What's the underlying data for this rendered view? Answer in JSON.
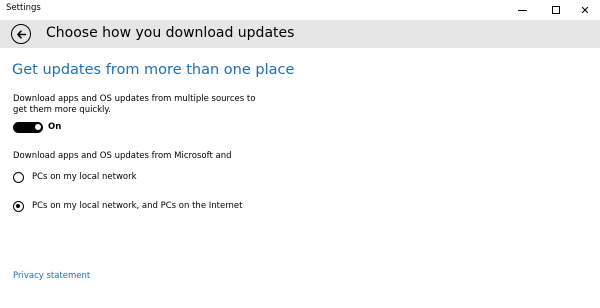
{
  "window": {
    "title": "Settings",
    "controls": [
      "minimize-icon",
      "maximize-icon",
      "close-icon"
    ],
    "close_glyph": "✕"
  },
  "header": {
    "back_icon": "back-arrow-icon",
    "title": "Choose how you download updates"
  },
  "section": {
    "title": "Get updates from more than one place",
    "description": "Download apps and OS updates from multiple sources to get them more quickly.",
    "toggle": {
      "state": true,
      "label": "On"
    },
    "group_label": "Download apps and OS updates from Microsoft and",
    "options": [
      {
        "label": "PCs on my local network",
        "selected": false
      },
      {
        "label": "PCs on my local network, and PCs on the Internet",
        "selected": true
      }
    ]
  },
  "footer": {
    "privacy_link": "Privacy statement"
  },
  "colors": {
    "accent": "#1f6fb3",
    "header_bg": "#e6e6e6"
  }
}
